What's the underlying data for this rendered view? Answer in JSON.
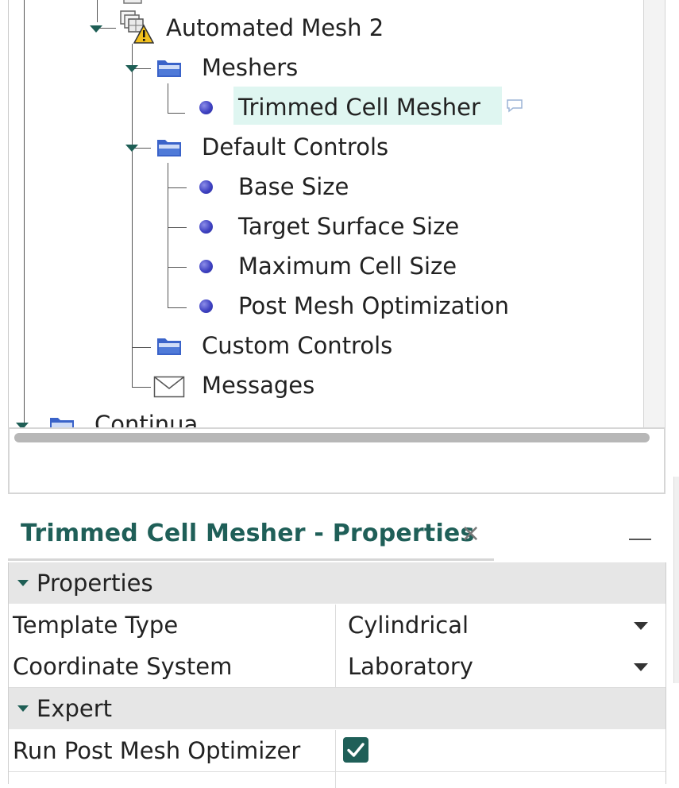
{
  "tree": {
    "nodes": {
      "automated_mesh": "Automated Mesh 2",
      "meshers": "Meshers",
      "trimmed_cell_mesher": "Trimmed Cell Mesher",
      "default_controls": "Default Controls",
      "base_size": "Base Size",
      "target_surface_size": "Target Surface Size",
      "maximum_cell_size": "Maximum Cell Size",
      "post_mesh_optimization": "Post Mesh Optimization",
      "custom_controls": "Custom Controls",
      "messages": "Messages",
      "continua": "Continua"
    },
    "selected": "Trimmed Cell Mesher"
  },
  "properties_panel": {
    "title": "Trimmed Cell Mesher - Properties",
    "close_glyph": "×",
    "sections": {
      "properties": "Properties",
      "expert": "Expert"
    },
    "rows": {
      "template_type": {
        "label": "Template Type",
        "value": "Cylindrical"
      },
      "coordinate_system": {
        "label": "Coordinate System",
        "value": "Laboratory"
      },
      "run_post_mesh_optimizer": {
        "label": "Run Post Mesh Optimizer",
        "checked": true
      }
    }
  },
  "colors": {
    "accent": "#1f5f58",
    "selection": "#dff6f1",
    "bullet": "#3f42c2",
    "folder": "#3a63c9",
    "section_bg": "#e6e6e6"
  },
  "icons": [
    "mesh-warning-icon",
    "folder-icon",
    "bullet-icon",
    "envelope-icon",
    "comment-icon",
    "close-icon",
    "minimize-icon",
    "dropdown-arrow-icon",
    "checkbox-checked-icon",
    "expand-arrow-icon"
  ]
}
